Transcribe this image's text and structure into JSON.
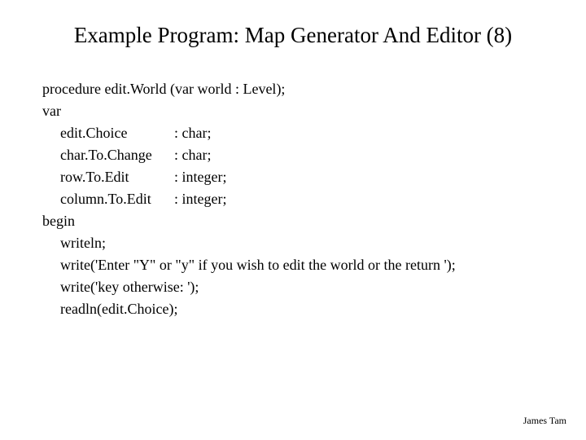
{
  "title": "Example Program: Map Generator And Editor (8)",
  "code": {
    "l1": "procedure edit.World (var world : Level);",
    "l2": "var",
    "l3_name": "edit.Choice",
    "l3_type": ": char;",
    "l4_name": "char.To.Change",
    "l4_type": ": char;",
    "l5_name": "row.To.Edit",
    "l5_type": ": integer;",
    "l6_name": "column.To.Edit",
    "l6_type": ": integer;",
    "l7": "begin",
    "l8": "writeln;",
    "l9": "write('Enter \"Y\" or \"y\" if you wish to edit the world or the return ');",
    "l10": "write('key otherwise: ');",
    "l11": "readln(edit.Choice);"
  },
  "footer": "James Tam"
}
